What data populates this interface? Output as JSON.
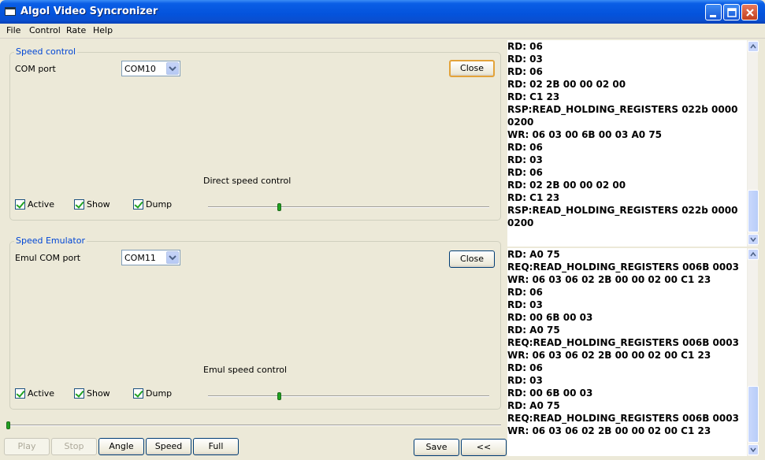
{
  "window": {
    "title": "Algol Video Syncronizer"
  },
  "menu": [
    "File",
    "Control",
    "Rate",
    "Help"
  ],
  "speed_control": {
    "title": "Speed control",
    "com_label": "COM port",
    "com_value": "COM10",
    "close_label": "Close",
    "direct_label": "Direct speed control",
    "checks": [
      "Active",
      "Show",
      "Dump"
    ],
    "slider_fraction": 0.25
  },
  "speed_emulator": {
    "title": "Speed Emulator",
    "com_label": "Emul COM port",
    "com_value": "COM11",
    "close_label": "Close",
    "emul_label": "Emul speed control",
    "checks": [
      "Active",
      "Show",
      "Dump"
    ],
    "slider_fraction": 0.25
  },
  "bottom": {
    "play": "Play",
    "stop": "Stop",
    "angle": "Angle",
    "speed": "Speed",
    "full": "Full",
    "save": "Save",
    "collapse": "<<"
  },
  "log_top": [
    "RD: 06",
    "RD: 03",
    "RD: 06",
    "RD: 02 2B 00 00 02 00",
    "RD: C1 23",
    "RSP:READ_HOLDING_REGISTERS 022b 0000",
    "0200",
    "WR: 06 03 00 6B 00 03 A0 75",
    "RD: 06",
    "RD: 03",
    "RD: 06",
    "RD: 02 2B 00 00 02 00",
    "RD: C1 23",
    "RSP:READ_HOLDING_REGISTERS 022b 0000",
    "0200"
  ],
  "log_bottom": [
    "RD: A0 75",
    "REQ:READ_HOLDING_REGISTERS 006B 0003",
    "WR: 06 03 06 02 2B 00 00 02 00 C1 23",
    "RD: 06",
    "RD: 03",
    "RD: 00 6B 00 03",
    "RD: A0 75",
    "REQ:READ_HOLDING_REGISTERS 006B 0003",
    "WR: 06 03 06 02 2B 00 00 02 00 C1 23",
    "RD: 06",
    "RD: 03",
    "RD: 00 6B 00 03",
    "RD: A0 75",
    "REQ:READ_HOLDING_REGISTERS 006B 0003",
    "WR: 06 03 06 02 2B 00 00 02 00 C1 23"
  ],
  "icons": {
    "minimize": "minimize-icon",
    "maximize": "maximize-icon",
    "close": "close-icon"
  }
}
